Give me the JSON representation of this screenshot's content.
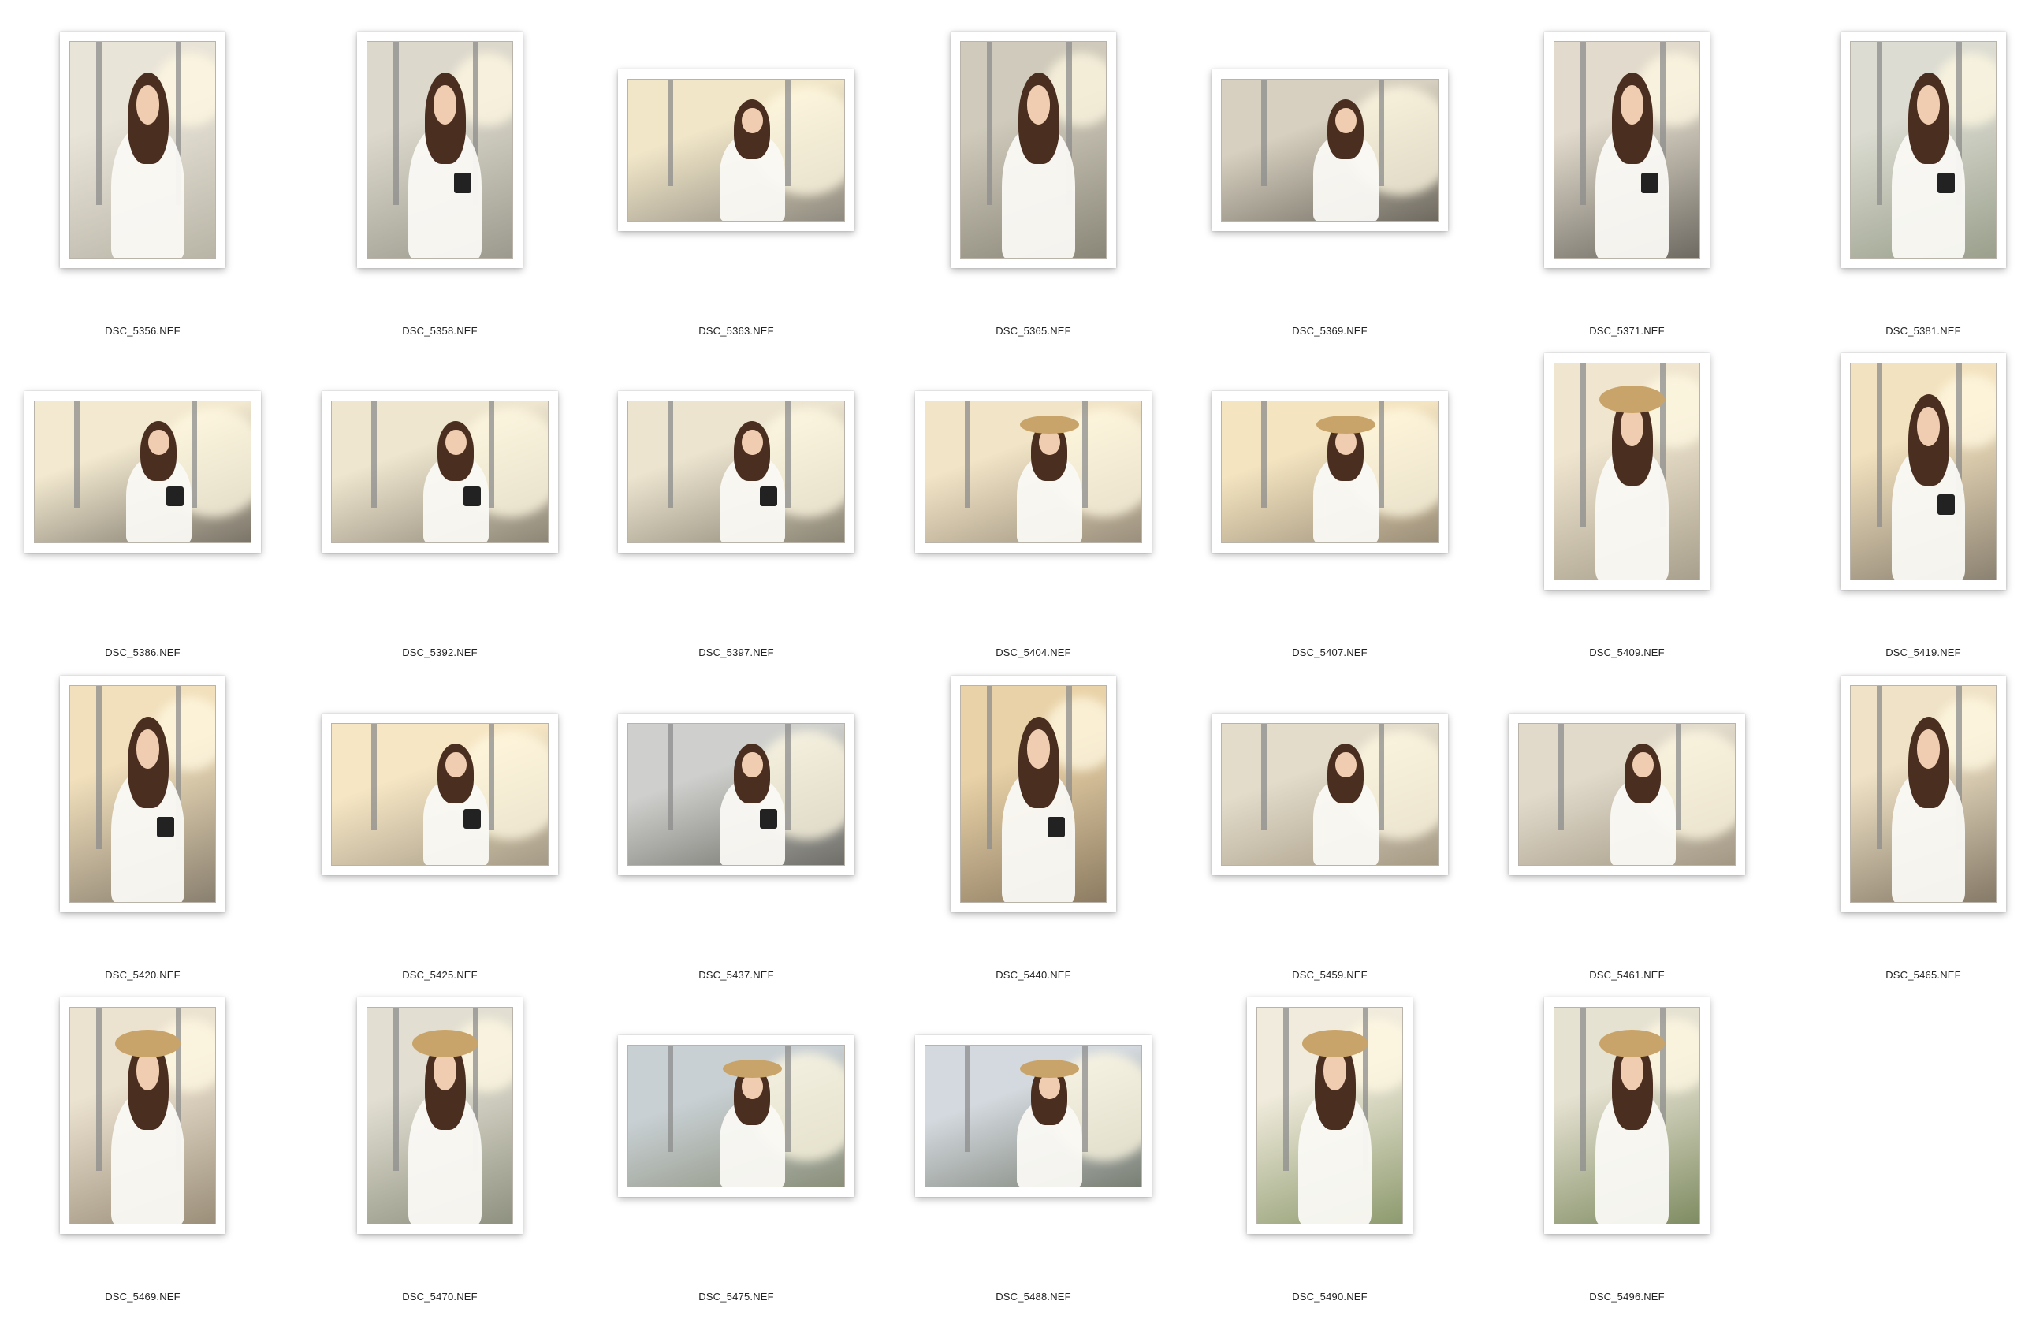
{
  "photos": [
    {
      "name": "DSC_5356.NEF",
      "orientation": "portrait",
      "tone": [
        "#e9e4d8",
        "#b8b4a6"
      ],
      "hat": false,
      "camera": false
    },
    {
      "name": "DSC_5358.NEF",
      "orientation": "portrait",
      "tone": [
        "#dcd8cc",
        "#9c9a8e"
      ],
      "hat": false,
      "camera": true
    },
    {
      "name": "DSC_5363.NEF",
      "orientation": "landscape",
      "tone": [
        "#f1e6c8",
        "#8f8a80"
      ],
      "hat": false,
      "camera": false
    },
    {
      "name": "DSC_5365.NEF",
      "orientation": "portrait",
      "tone": [
        "#cfcabb",
        "#8a8678"
      ],
      "hat": false,
      "camera": false
    },
    {
      "name": "DSC_5369.NEF",
      "orientation": "landscape",
      "tone": [
        "#d7d0c0",
        "#6f6a60"
      ],
      "hat": false,
      "camera": false
    },
    {
      "name": "DSC_5371.NEF",
      "orientation": "portrait",
      "tone": [
        "#e2dbcd",
        "#6e6a62"
      ],
      "hat": false,
      "camera": true
    },
    {
      "name": "DSC_5381.NEF",
      "orientation": "portrait",
      "tone": [
        "#dcdcd2",
        "#9aa08c"
      ],
      "hat": false,
      "camera": true
    },
    {
      "name": "DSC_5386.NEF",
      "orientation": "landscape",
      "tone": [
        "#f3e9d0",
        "#7a7468"
      ],
      "hat": false,
      "camera": true
    },
    {
      "name": "DSC_5392.NEF",
      "orientation": "landscape",
      "tone": [
        "#efe6cf",
        "#8d8676"
      ],
      "hat": false,
      "camera": true
    },
    {
      "name": "DSC_5397.NEF",
      "orientation": "landscape",
      "tone": [
        "#ece4cf",
        "#8a8474"
      ],
      "hat": false,
      "camera": true
    },
    {
      "name": "DSC_5404.NEF",
      "orientation": "landscape",
      "tone": [
        "#f2e4c6",
        "#9a8f7c"
      ],
      "hat": true,
      "camera": false
    },
    {
      "name": "DSC_5407.NEF",
      "orientation": "landscape",
      "tone": [
        "#f4e4c0",
        "#9b8e78"
      ],
      "hat": true,
      "camera": false
    },
    {
      "name": "DSC_5409.NEF",
      "orientation": "portrait",
      "tone": [
        "#f0e6d0",
        "#a89f8c"
      ],
      "hat": true,
      "camera": false
    },
    {
      "name": "DSC_5419.NEF",
      "orientation": "portrait",
      "tone": [
        "#f3e2bf",
        "#8c8272"
      ],
      "hat": false,
      "camera": true
    },
    {
      "name": "DSC_5420.NEF",
      "orientation": "portrait",
      "tone": [
        "#f2e0bc",
        "#8a8070"
      ],
      "hat": false,
      "camera": true
    },
    {
      "name": "DSC_5425.NEF",
      "orientation": "landscape",
      "tone": [
        "#f6e6c4",
        "#a49a86"
      ],
      "hat": false,
      "camera": true
    },
    {
      "name": "DSC_5437.NEF",
      "orientation": "landscape",
      "tone": [
        "#cfd0cd",
        "#6f6e68"
      ],
      "hat": false,
      "camera": true
    },
    {
      "name": "DSC_5440.NEF",
      "orientation": "portrait",
      "tone": [
        "#e9d2a8",
        "#8d7c62"
      ],
      "hat": false,
      "camera": true
    },
    {
      "name": "DSC_5459.NEF",
      "orientation": "landscape",
      "tone": [
        "#e3dccb",
        "#a69a84"
      ],
      "hat": false,
      "camera": false
    },
    {
      "name": "DSC_5461.NEF",
      "orientation": "landscape",
      "tone": [
        "#e1dacb",
        "#a39884"
      ],
      "hat": false,
      "camera": false
    },
    {
      "name": "DSC_5465.NEF",
      "orientation": "portrait",
      "tone": [
        "#efe2c6",
        "#867a68"
      ],
      "hat": false,
      "camera": false
    },
    {
      "name": "DSC_5469.NEF",
      "orientation": "portrait",
      "tone": [
        "#ece2d0",
        "#9b8f7a"
      ],
      "hat": true,
      "camera": false
    },
    {
      "name": "DSC_5470.NEF",
      "orientation": "portrait",
      "tone": [
        "#e2dfd2",
        "#8f9180"
      ],
      "hat": true,
      "camera": false
    },
    {
      "name": "DSC_5475.NEF",
      "orientation": "landscape",
      "tone": [
        "#c9d0d4",
        "#8a8f7a"
      ],
      "hat": true,
      "camera": false
    },
    {
      "name": "DSC_5488.NEF",
      "orientation": "landscape",
      "tone": [
        "#d3d9de",
        "#7a7f74"
      ],
      "hat": true,
      "camera": false
    },
    {
      "name": "DSC_5490.NEF",
      "orientation": "portrait",
      "tone": [
        "#f0ebdc",
        "#8d9a6e"
      ],
      "hat": true,
      "camera": false
    },
    {
      "name": "DSC_5496.NEF",
      "orientation": "portrait",
      "tone": [
        "#e6e2d2",
        "#7f8c62"
      ],
      "hat": true,
      "camera": false
    }
  ]
}
